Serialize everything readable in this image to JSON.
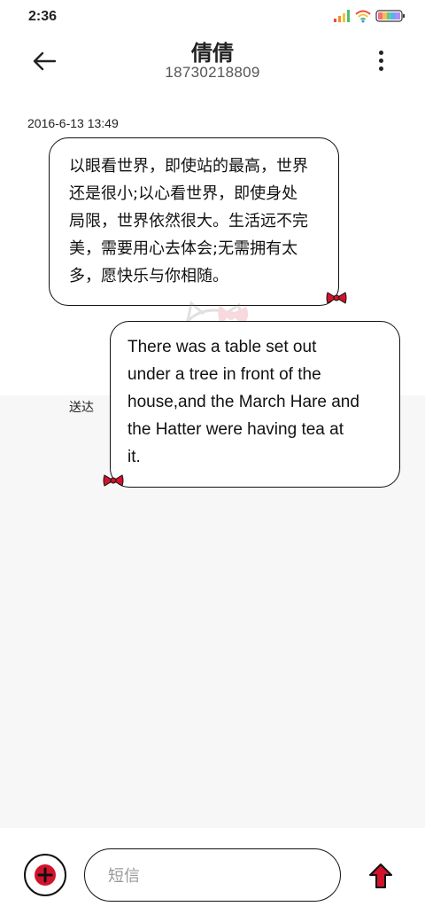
{
  "status_bar": {
    "time": "2:36",
    "icons": [
      "signal-icon",
      "wifi-icon",
      "battery-icon"
    ]
  },
  "header": {
    "contact_name": "倩倩",
    "phone_number": "18730218809",
    "back_icon": "back-arrow-icon",
    "more_icon": "more-vert-icon"
  },
  "conversation": {
    "timestamp": "2016-6-13 13:49",
    "messages": [
      {
        "direction": "incoming",
        "lines": [
          "以眼看世界，即使站的最高，世界",
          "还是很小;以心看世界，即使身处",
          "局限，世界依然很大。生活远不完",
          "美，需要用心去体会;无需拥有太",
          "多，愿快乐与你相随。"
        ]
      },
      {
        "direction": "outgoing",
        "lines": [
          "There was a table set out",
          "under a tree in front of the",
          "house,and the March Hare and",
          "the Hatter were having tea at",
          "it."
        ],
        "status": "送达"
      }
    ]
  },
  "input_bar": {
    "placeholder": "短信",
    "add_icon": "add-circle-icon",
    "send_icon": "send-arrow-icon"
  },
  "colors": {
    "accent": "#d0142c",
    "bubble_border": "#111111",
    "lower_background": "#f7f7f7"
  }
}
